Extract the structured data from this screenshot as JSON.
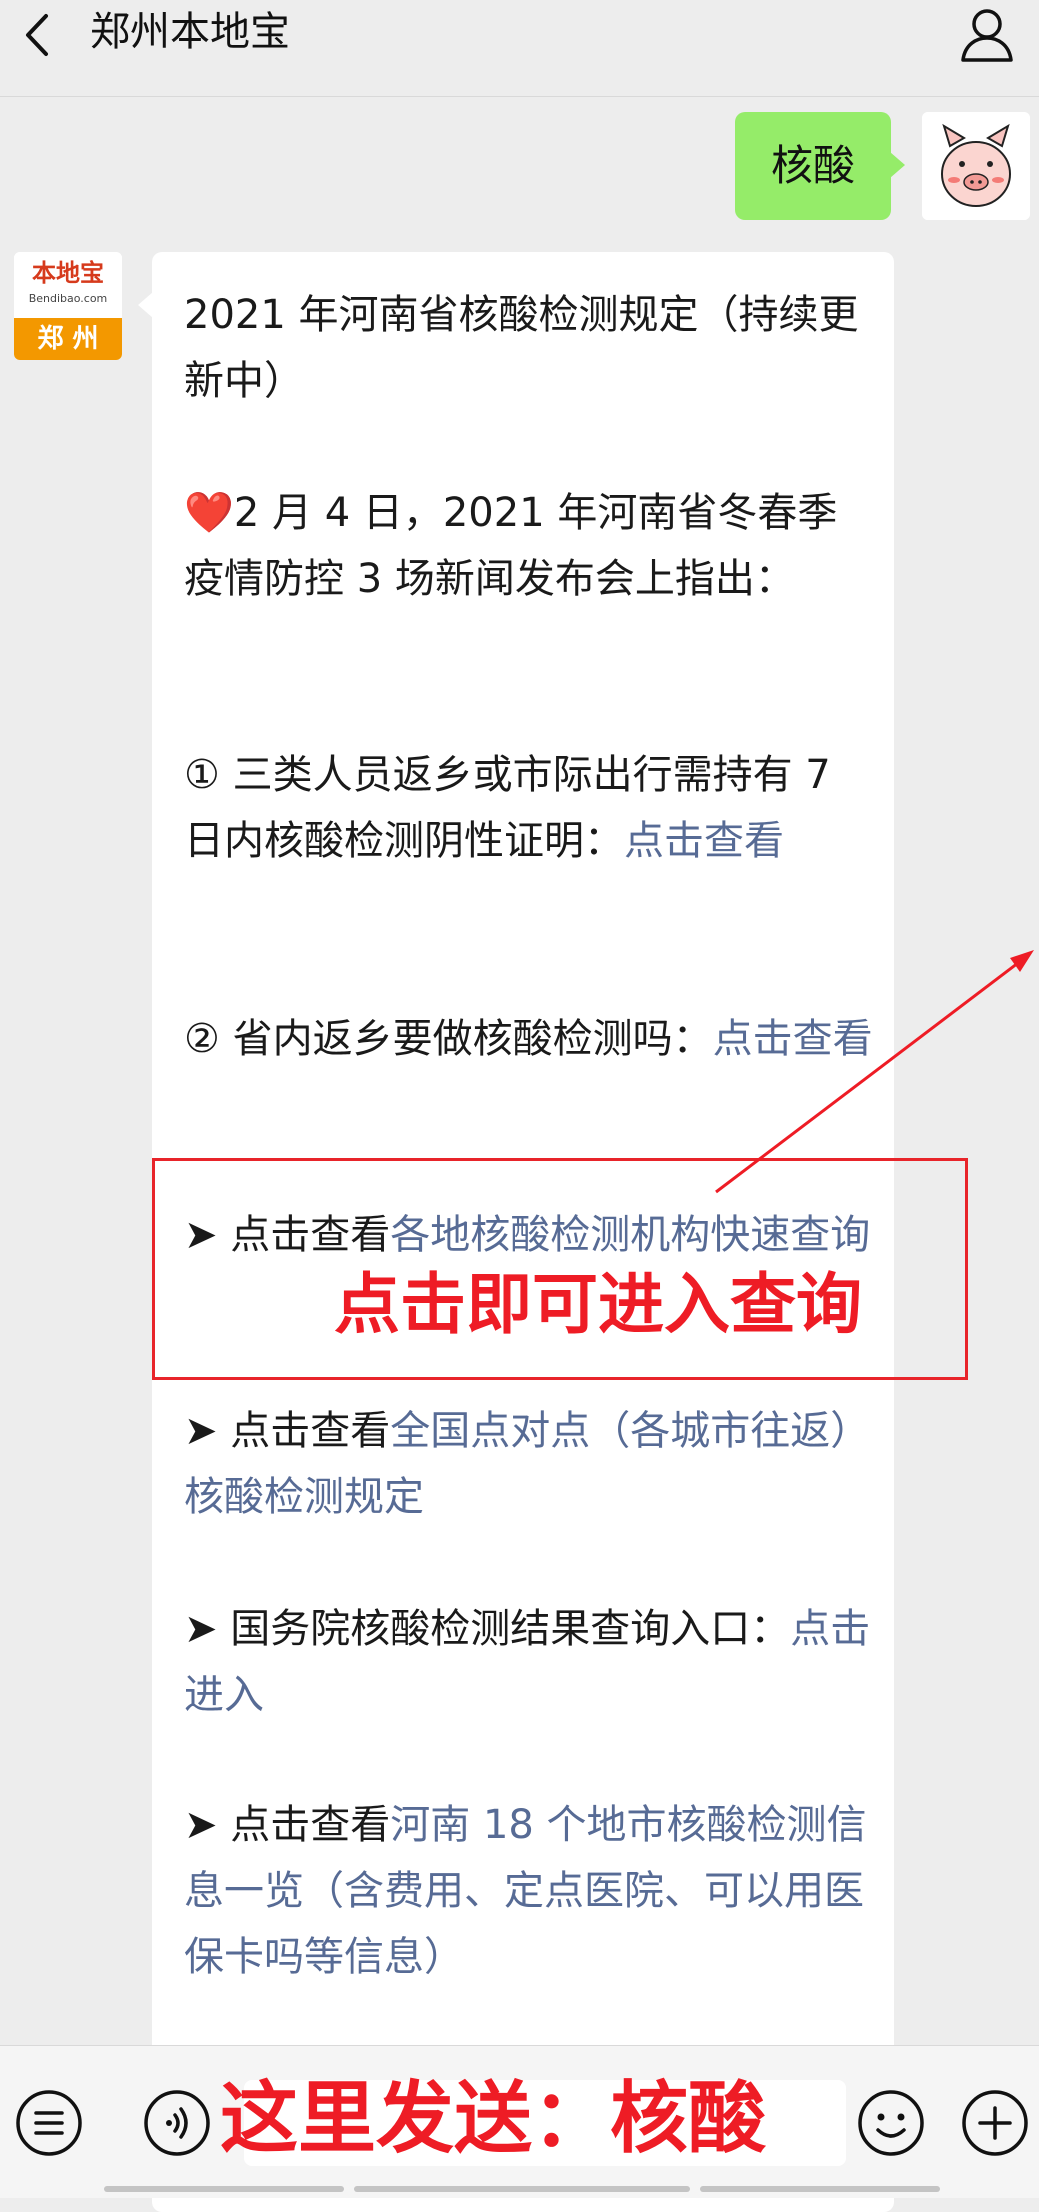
{
  "header": {
    "title": "郑州本地宝"
  },
  "chat": {
    "sent_message": "核酸",
    "bot_logo_text": "本地宝",
    "bot_logo_sub": "Bendibao.com",
    "bot_logo_city": "郑 州",
    "message": {
      "title": "2021 年河南省核酸检测规定（持续更新中）",
      "intro_heart": "❤️",
      "intro": "2 月 4 日，2021 年河南省冬春季疫情防控 3 场新闻发布会上指出：",
      "item1_text": "① 三类人员返乡或市际出行需持有 7 日内核酸检测阴性证明：",
      "item1_link": "点击查看",
      "item2_text": "② 省内返乡要做核酸检测吗：",
      "item2_link": "点击查看",
      "item3_text": "➤ 点击查看",
      "item3_link": "各地核酸检测机构快速查询",
      "item4_text": "➤ 点击查看",
      "item4_link": "全国点对点（各城市往返）核酸检测规定",
      "item5_text": "➤ 国务院核酸检测结果查询入口：",
      "item5_link": "点击进入",
      "item6_text": "➤ 点击查看",
      "item6_link": "河南 18 个地市核酸检测信息一览（含费用、定点医院、可以用医保卡吗等信息）"
    }
  },
  "annotations": {
    "box_label": "点击即可进入查询",
    "bottom_label": "这里发送：核酸"
  },
  "colors": {
    "link": "#576b95",
    "sent_bubble": "#95ec69",
    "annotation_red": "#ee1c25"
  }
}
